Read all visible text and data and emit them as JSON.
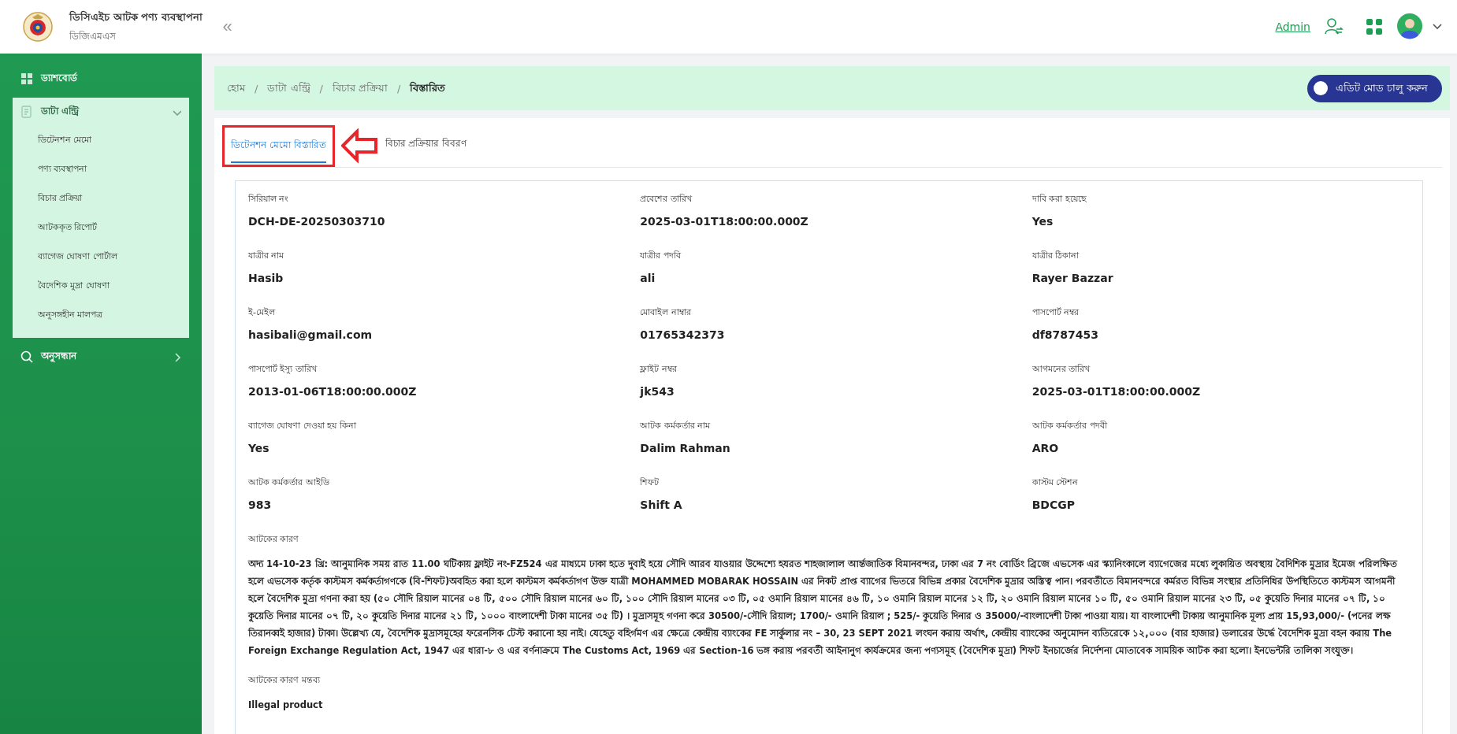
{
  "header": {
    "app_title": "ডিসিএইচ আটক পণ্য ব্যবস্থাপনা",
    "app_subtitle": "ডিজিএমএস",
    "collapse_glyph": "«",
    "user_link": "Admin"
  },
  "sidebar": {
    "items": [
      {
        "label": "ড্যাশবোর্ড",
        "selected": false
      },
      {
        "label": "ডাটা এন্ট্রি",
        "selected": true,
        "expanded": true,
        "children": [
          {
            "label": "ডিটেনশন মেমো",
            "selected": false
          },
          {
            "label": "পণ্য ব্যবস্থাপনা",
            "selected": false
          },
          {
            "label": "বিচার প্রক্রিয়া",
            "selected": false
          },
          {
            "label": "আটককৃত রিপোর্ট",
            "selected": false
          },
          {
            "label": "ব্যাগেজ ঘোষণা পোর্টাল",
            "selected": false
          },
          {
            "label": "বৈদেশিক মুদ্রা ঘোষণা",
            "selected": false
          },
          {
            "label": "অনুসঙ্গহীন মালপত্র",
            "selected": false
          }
        ]
      },
      {
        "label": "অনুসন্ধান",
        "selected": false,
        "expanded": false
      }
    ]
  },
  "breadcrumb": [
    {
      "kind": "link",
      "text": "হোম"
    },
    {
      "kind": "separator",
      "text": "/"
    },
    {
      "kind": "link",
      "text": "ডাটা এন্ট্রি"
    },
    {
      "kind": "separator",
      "text": "/"
    },
    {
      "kind": "link",
      "text": "বিচার প্রক্রিয়া"
    },
    {
      "kind": "separator",
      "text": "/"
    },
    {
      "kind": "current",
      "text": "বিস্তারিত"
    }
  ],
  "edit_mode_toggle": {
    "label": "এডিট মোড চালু করুন",
    "on": false
  },
  "tabs": [
    {
      "label": "ডিটেনশন মেমো বিস্তারিত",
      "selected": true
    },
    {
      "label": "বিচার প্রক্রিয়ার বিবরণ",
      "selected": false
    }
  ],
  "fields": [
    {
      "label": "সিরিয়াল নং",
      "value": "DCH-DE-20250303710"
    },
    {
      "label": "প্রবেশের তারিখ",
      "value": "2025-03-01T18:00:00.000Z"
    },
    {
      "label": "দাবি করা হয়েছে",
      "value": "Yes"
    },
    {
      "label": "যাত্রীর নাম",
      "value": "Hasib"
    },
    {
      "label": "যাত্রীর পদবি",
      "value": "ali"
    },
    {
      "label": "যাত্রীর ঠিকানা",
      "value": "Rayer Bazzar"
    },
    {
      "label": "ই-মেইল",
      "value": "hasibali@gmail.com"
    },
    {
      "label": "মোবাইল নাম্বার",
      "value": "01765342373"
    },
    {
      "label": "পাসপোর্ট নম্বর",
      "value": "df8787453"
    },
    {
      "label": "পাসপোর্ট ইস্যু তারিখ",
      "value": "2013-01-06T18:00:00.000Z"
    },
    {
      "label": "ফ্লাইট নম্বর",
      "value": "jk543"
    },
    {
      "label": "আগমনের তারিখ",
      "value": "2025-03-01T18:00:00.000Z"
    },
    {
      "label": "ব্যাগেজ ঘোষণা দেওয়া হয় কিনা",
      "value": "Yes"
    },
    {
      "label": "আটক কর্মকর্তার নাম",
      "value": "Dalim Rahman"
    },
    {
      "label": "আটক কর্মকর্তার পদবী",
      "value": "ARO"
    },
    {
      "label": "আটক কর্মকর্তার আইডি",
      "value": "983"
    },
    {
      "label": "শিফট",
      "value": "Shift A"
    },
    {
      "label": "কাস্টম স্টেশন",
      "value": "BDCGP"
    }
  ],
  "long_fields": [
    {
      "label": "আটকের কারণ",
      "value": "অদ্য 14-10-23 খ্রি: আনুমানিক সময় রাত 11.00 ঘটিকায় ফ্লাইট নং-FZ524 এর মাধ্যমে ঢাকা হতে দুবাই হয়ে সৌদি আরব যাওয়ার উদ্দেশ্যে হযরত শাহজালাল আর্ন্তজাতিক বিমানবন্দর, ঢাকা এর 7 নং বোর্ডিং ব্রিজে এভসেক এর স্ক্যানিংকালে ব্যাগেজের মধ্যে লুকায়িত অবস্থায় বৈদিশিক মুদ্রার ইমেজ পরিলক্ষিত হলে এভসেক কর্তৃক কাস্টমস কর্মকর্তাগণকে (বি-শিফট)অবহিত করা হলে কাস্টমস কর্মকর্তাগণ উক্ত যাত্রী MOHAMMED MOBARAK HOSSAIN এর নিকট প্রাপ্ত ব্যাগের ভিতরে বিভিন্ন প্রকার বৈদেশিক মুদ্রার অস্তিত্ব পান। পরবর্তীতে বিমানবন্দরে কর্মরত বিভিন্ন সংস্থার প্রতিনিধির উপস্থিতিতে কাস্টমস আগমনী হলে বৈদেশিক মুদ্রা গণনা করা হয় (৫০ সৌদি রিয়াল মানের ০৪ টি, ৫০০ সৌদি রিয়াল মানের ৬০ টি, ১০০ সৌদি রিয়াল মানের ০৩ টি, ০৫ ওমানি রিয়াল মানের ৪৬ টি, ১০ ওমানি রিয়াল মানের ১২ টি, ২০ ওমানি রিয়াল মানের ১০ টি, ৫০ ওমানি রিয়াল মানের ২৩ টি, ০৫ কুয়েতি দিনার মানের ০৭ টি, ১০ কুয়েতি দিনার মানের ০৭ টি, ২০ কুয়েতি দিনার মানের ২১ টি, ১০০০ বাংলাদেশী টাকা মানের ৩৫ টি) । মুদ্রাসমূহ গণনা করে 30500/-সৌদি রিয়াল; 1700/- ওমানি রিয়াল ; 525/- কুয়েতি দিনার ও 35000/-বাংলাদেশী টাকা পাওয়া যায়। যা বাংলাদেশী টাকায় আনুমানিক মূল্য প্রায় 15,93,000/- (পনের লক্ষ তিরানব্বই হাজার) টাকা। উল্লেখ্য যে, বৈদেশিক মুদ্রাসমূহের ফরেনসিক টেস্ট করানো হয় নাই। যেহেতু বহির্গমণ এর ক্ষেত্রে কেন্দ্রীয় ব্যাংকের FE সার্কুলার নং – 30, 23 SEPT 2021 লংঘন করায় অর্থাৎ, কেন্দ্রীয় ব্যাংকের অনুমোদন ব্যতিরেকে ১২,০০০ (বার হাজার) ডলারের উর্দ্ধে বৈদেশিক মুদ্রা বহন করায় The Foreign Exchange Regulation Act, 1947 এর ধারা-৮ ও এর বর্ণনাক্রমে The Customs Act, 1969 এর Section-16 ভঙ্গ করায় পরবর্তী আইনানুগ কার্যক্রমের জন্য পণ্যসমূহ (বৈদেশিক মুদ্রা) শিফট ইনচার্জের নির্দেশনা মোতাবেক সাময়িক আটক করা হলো। ইনভেন্টরি তালিকা সংযুক্ত।"
    },
    {
      "label": "আটকের কারণ মন্তব্য",
      "value": "Illegal product"
    }
  ]
}
